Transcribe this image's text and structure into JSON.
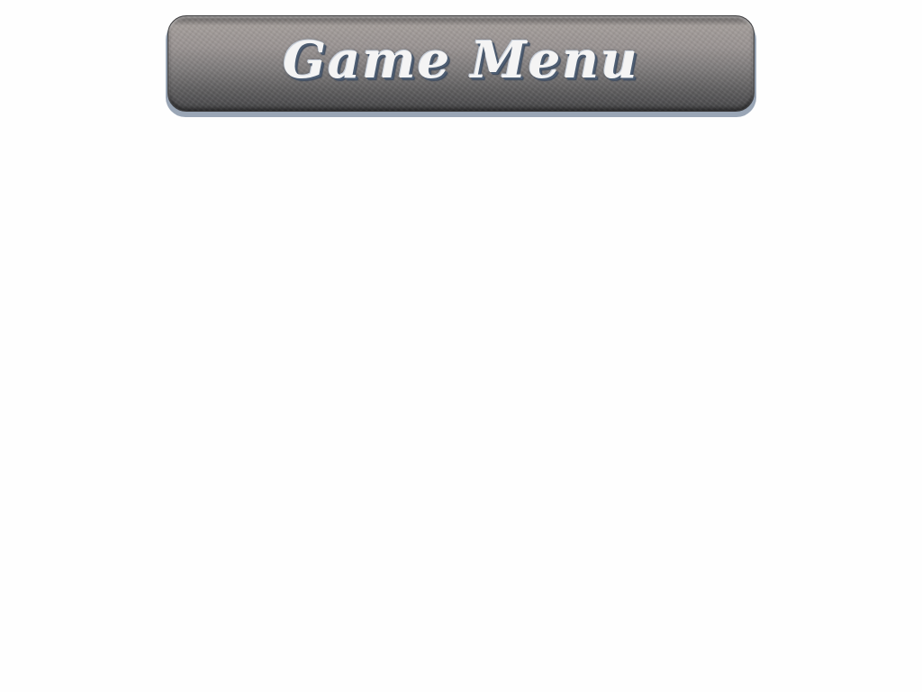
{
  "menu": {
    "title": "Game Menu"
  },
  "colors": {
    "background": "#fefefe",
    "banner_top": "#a39d9a",
    "banner_bottom": "#454547",
    "banner_shadow": "#9aa6b6",
    "title_text": "#f4f4f4",
    "title_outline": "#4d5d72"
  }
}
